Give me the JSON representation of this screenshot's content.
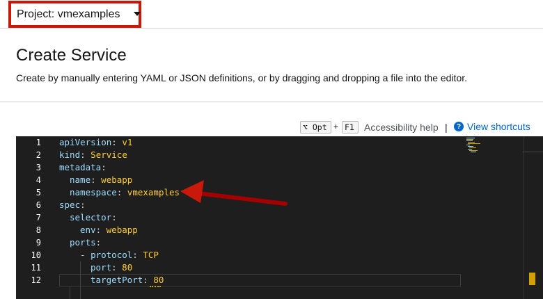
{
  "project_selector": {
    "label": "Project: vmexamples"
  },
  "header": {
    "title": "Create Service",
    "description": "Create by manually entering YAML or JSON definitions, or by dragging and dropping a file into the editor."
  },
  "toolbar": {
    "key_opt": "⌥ Opt",
    "plus": "+",
    "key_f1": "F1",
    "accessibility_help": "Accessibility help",
    "separator": "|",
    "view_shortcuts": "View shortcuts"
  },
  "editor": {
    "line_numbers": [
      "1",
      "2",
      "3",
      "4",
      "5",
      "6",
      "7",
      "8",
      "9",
      "10",
      "11",
      "12"
    ],
    "lines": [
      {
        "key": "apiVersion",
        "sep": ": ",
        "value": "v1"
      },
      {
        "key": "kind",
        "sep": ": ",
        "value": "Service"
      },
      {
        "key": "metadata",
        "sep": ":",
        "value": ""
      },
      {
        "key": "name",
        "sep": ": ",
        "value": "webapp"
      },
      {
        "key": "namespace",
        "sep": ": ",
        "value": "vmexamples"
      },
      {
        "key": "spec",
        "sep": ":",
        "value": ""
      },
      {
        "key": "selector",
        "sep": ":",
        "value": ""
      },
      {
        "key": "env",
        "sep": ": ",
        "value": "webapp"
      },
      {
        "key": "ports",
        "sep": ":",
        "value": ""
      },
      {
        "key": "protocol",
        "sep": ": ",
        "value": "TCP"
      },
      {
        "key": "port",
        "sep": ": ",
        "value": "80"
      },
      {
        "key": "targetPort",
        "sep": ": ",
        "value": "80"
      }
    ],
    "current_line": "12"
  },
  "colors": {
    "highlight_border": "#c9190b",
    "link": "#0066cc",
    "editor_bg": "#1e1e1e",
    "yaml_key": "#9cdcfe",
    "yaml_value": "#ffcc33"
  }
}
